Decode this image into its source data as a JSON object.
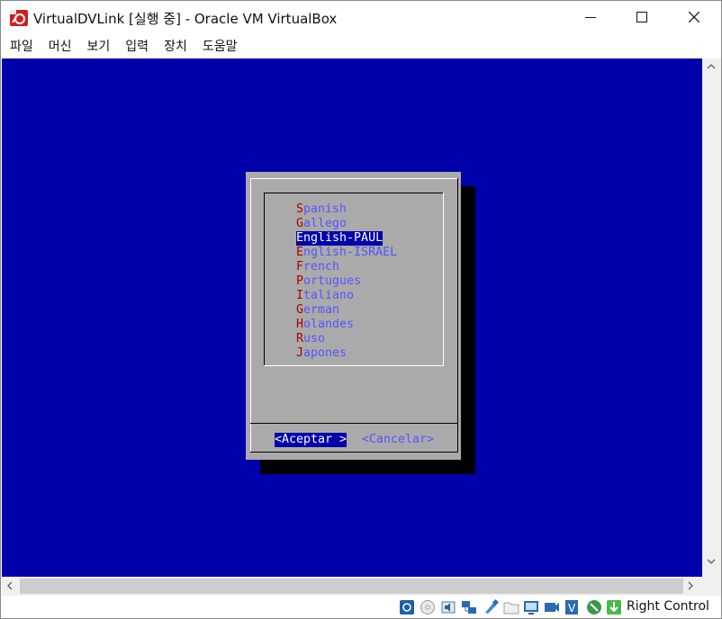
{
  "window": {
    "title": "VirtualDVLink [실행 중] - Oracle VM VirtualBox",
    "controls": [
      "minimize",
      "maximize",
      "close"
    ]
  },
  "menu": [
    "파일",
    "머신",
    "보기",
    "입력",
    "장치",
    "도움말"
  ],
  "dialog": {
    "options": [
      {
        "hotkey": "S",
        "rest": "panish"
      },
      {
        "hotkey": "G",
        "rest": "allego"
      },
      {
        "hotkey": "E",
        "rest": "nglish-PAUL"
      },
      {
        "hotkey": "E",
        "rest": "nglish-ISRAEL"
      },
      {
        "hotkey": "F",
        "rest": "rench"
      },
      {
        "hotkey": "P",
        "rest": "ortugues"
      },
      {
        "hotkey": "I",
        "rest": "taliano"
      },
      {
        "hotkey": "G",
        "rest": "erman"
      },
      {
        "hotkey": "H",
        "rest": "olandes"
      },
      {
        "hotkey": "R",
        "rest": "uso"
      },
      {
        "hotkey": "J",
        "rest": "apones"
      }
    ],
    "selected_index": 2,
    "ok_label": "<Aceptar >",
    "cancel_label": "<Cancelar>"
  },
  "statusbar": {
    "icons": [
      "hard-disk-icon",
      "optical-drive-icon",
      "audio-icon",
      "network-icon",
      "usb-icon",
      "shared-folders-icon",
      "display-icon",
      "video-capture-icon",
      "virtualization-icon",
      "mouse-integration-icon",
      "keyboard-capture-icon"
    ],
    "host_key": "Right Control"
  },
  "colors": {
    "screen_bg": "#0000aa",
    "dialog_bg": "#aaaaaa",
    "option_text": "#5555ff",
    "hotkey": "#aa0000",
    "selection_bg": "#0000aa"
  }
}
